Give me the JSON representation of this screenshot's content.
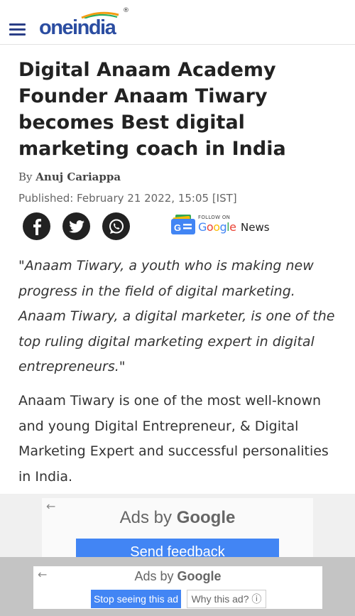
{
  "header": {
    "logo_text": "oneindia",
    "logo_registered": "®",
    "menu_icon": "hamburger-menu-icon",
    "brand_color": "#2b4da1"
  },
  "article": {
    "title": "Digital Anaam Academy Founder Anaam Tiwary becomes Best digital marketing coach in India",
    "byline_prefix": "By",
    "author": "Anuj Cariappa",
    "published": "Published: February 21 2022, 15:05 [IST]",
    "share": {
      "icons": [
        "facebook-icon",
        "twitter-icon",
        "whatsapp-icon"
      ]
    },
    "google_news": {
      "follow_label": "FOLLOW ON",
      "google": "Google",
      "news": "News"
    },
    "quote": "\"Anaam Tiwary, a youth who is making new progress in the field of digital marketing. Anaam Tiwary, a digital marketer, is one of the top ruling digital marketing expert in digital entrepreneurs.\"",
    "paragraph": "Anaam Tiwary is one of the most well-known and young Digital Entrepreneur, & Digital Marketing Expert and successful personalities in India."
  },
  "ad_primary": {
    "ads_by": "Ads by",
    "google": "Google",
    "send_feedback": "Send feedback"
  },
  "ad_secondary": {
    "ads_by": "Ads by",
    "google": "Google",
    "stop_seeing": "Stop seeing this ad",
    "why_this_ad": "Why this ad? ⓘ"
  }
}
